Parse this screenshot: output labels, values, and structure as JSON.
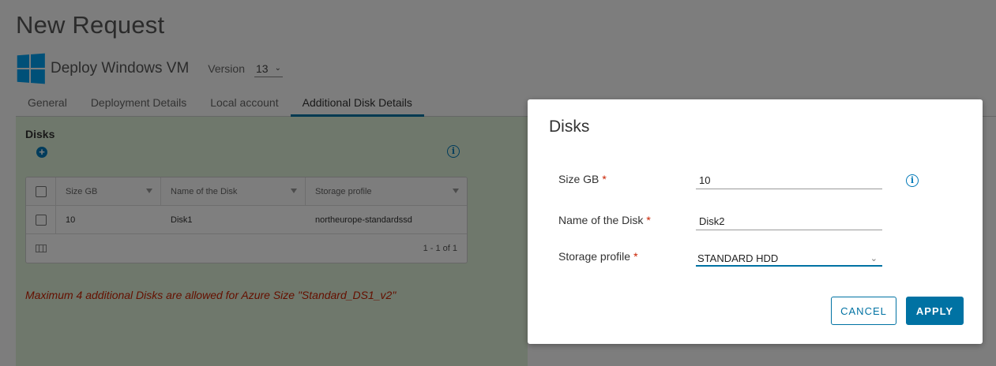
{
  "page": {
    "title": "New Request",
    "blueprint_name": "Deploy Windows VM",
    "version_label": "Version",
    "version_value": "13"
  },
  "tabs": [
    {
      "label": "General"
    },
    {
      "label": "Deployment Details"
    },
    {
      "label": "Local account"
    },
    {
      "label": "Additional Disk Details"
    }
  ],
  "disks_section": {
    "label": "Disks",
    "columns": [
      "Size GB",
      "Name of the Disk",
      "Storage profile"
    ],
    "rows": [
      {
        "size": "10",
        "name": "Disk1",
        "profile": "northeurope-standardssd"
      }
    ],
    "pagination": "1 - 1 of 1",
    "warning": "Maximum 4 additional Disks are allowed for Azure Size \"Standard_DS1_v2\""
  },
  "modal": {
    "title": "Disks",
    "fields": {
      "size_label": "Size GB",
      "size_value": "10",
      "name_label": "Name of the Disk",
      "name_value": "Disk2",
      "profile_label": "Storage profile",
      "profile_value": "STANDARD HDD"
    },
    "required_marker": "*",
    "cancel_label": "CANCEL",
    "apply_label": "APPLY"
  },
  "colors": {
    "accent": "#0072a3",
    "required": "#c92100",
    "content_bg": "#dff0d8"
  },
  "icons": [
    "windows-logo-icon",
    "chevron-down-icon",
    "add-circle-icon",
    "info-icon",
    "filter-icon",
    "column-toggle-icon"
  ]
}
